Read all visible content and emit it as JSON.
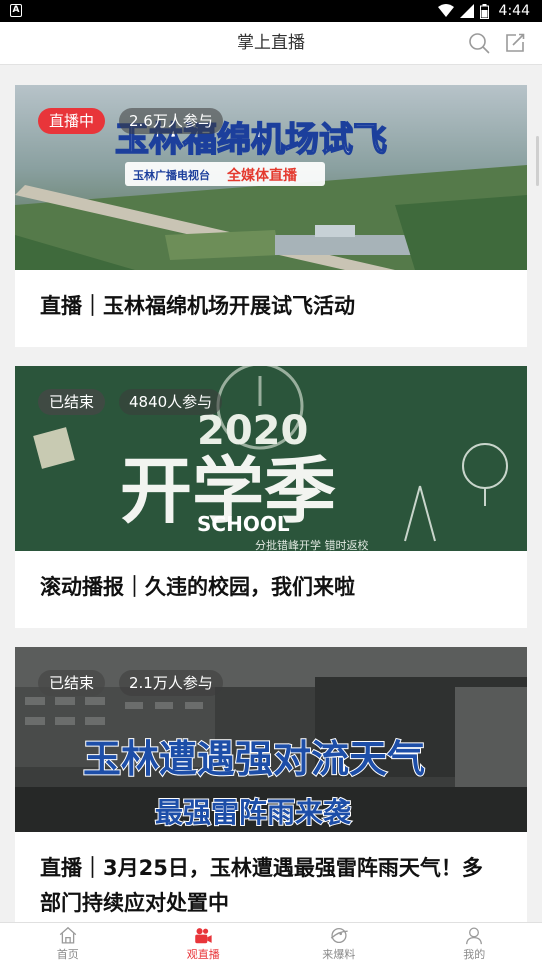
{
  "status_bar": {
    "time": "4:44"
  },
  "header": {
    "title": "掌上直播"
  },
  "cards": [
    {
      "status": "直播中",
      "participants": "2.6万人参与",
      "banner_headline": "玉林福绵机场试飞",
      "banner_sub": "全媒体直播",
      "banner_logo": "玉林广播电视台",
      "title": "直播｜玉林福绵机场开展试飞活动"
    },
    {
      "status": "已结束",
      "participants": "4840人参与",
      "banner_headline": "开学季",
      "banner_sub": "SCHOOL",
      "banner_year": "2020",
      "banner_note": "分批错峰开学 错时返校",
      "title": "滚动播报｜久违的校园，我们来啦"
    },
    {
      "status": "已结束",
      "participants": "2.1万人参与",
      "banner_headline": "玉林遭遇强对流天气",
      "banner_sub": "最强雷阵雨来袭",
      "title": "直播｜3月25日，玉林遭遇最强雷阵雨天气！多部门持续应对处置中"
    }
  ],
  "tabs": [
    {
      "label": "首页",
      "icon": "home-icon",
      "active": false
    },
    {
      "label": "观直播",
      "icon": "live-camera-icon",
      "active": true
    },
    {
      "label": "来爆料",
      "icon": "report-icon",
      "active": false
    },
    {
      "label": "我的",
      "icon": "profile-icon",
      "active": false
    }
  ],
  "colors": {
    "accent": "#e8353a",
    "live_badge": "#e8353a"
  }
}
